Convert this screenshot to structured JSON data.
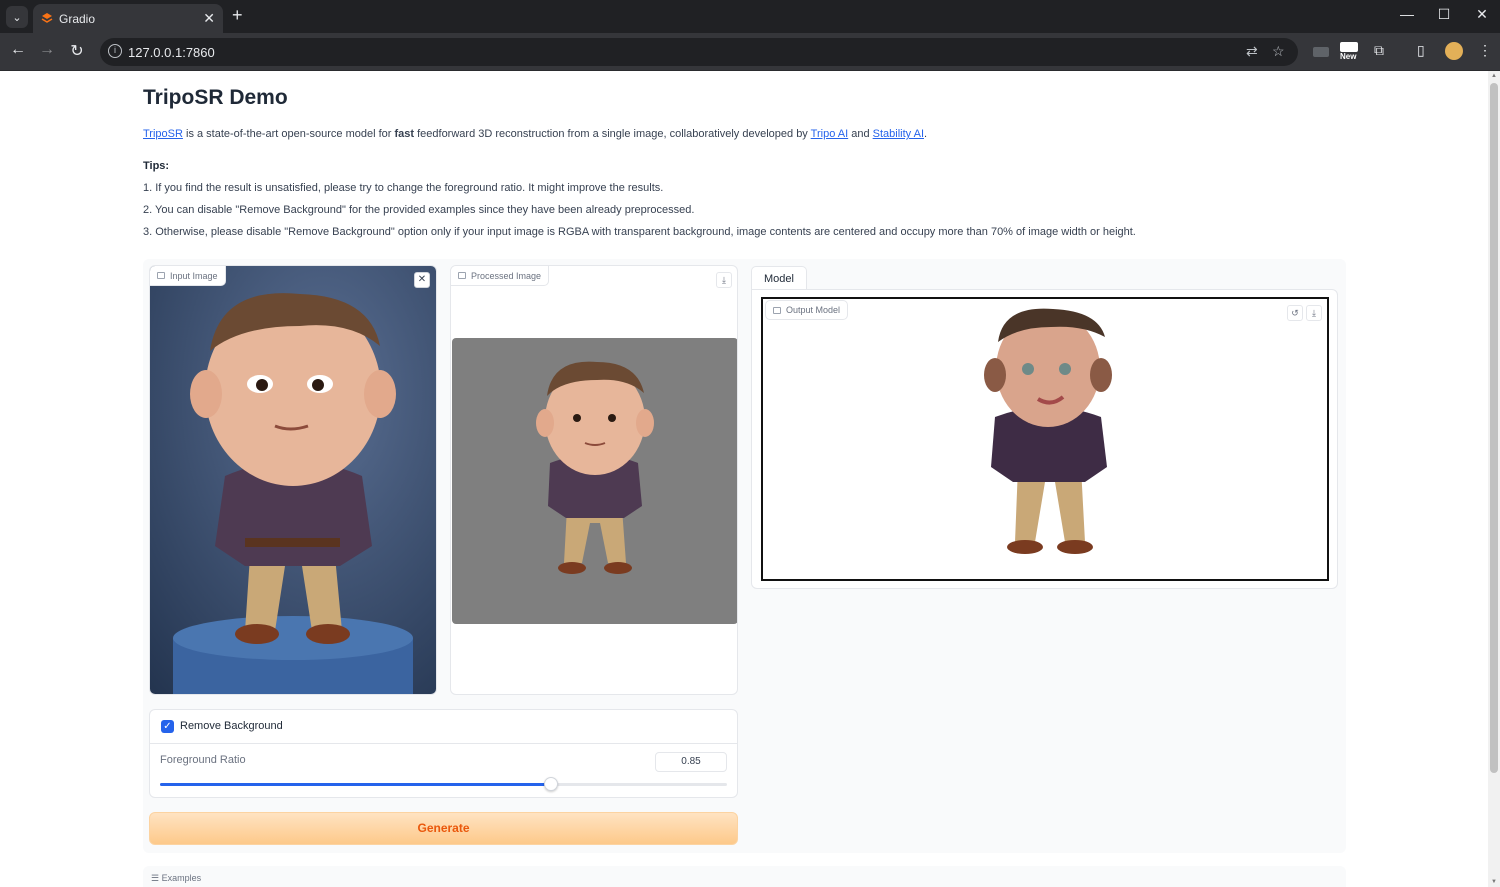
{
  "browser": {
    "tab_title": "Gradio",
    "url": "127.0.0.1:7860",
    "new_badge": "New"
  },
  "page": {
    "title": "TripoSR Demo",
    "intro": {
      "link1": "TripoSR",
      "text1": " is a state-of-the-art open-source model for ",
      "bold": "fast",
      "text2": " feedforward 3D reconstruction from a single image, collaboratively developed by ",
      "link2": "Tripo AI",
      "text3": " and ",
      "link3": "Stability AI",
      "text4": "."
    },
    "tips_title": "Tips:",
    "tips": [
      "1. If you find the result is unsatisfied, please try to change the foreground ratio. It might improve the results.",
      "2. You can disable \"Remove Background\" for the provided examples since they have been already preprocessed.",
      "3. Otherwise, please disable \"Remove Background\" option only if your input image is RGBA with transparent background, image contents are centered and occupy more than 70% of image width or height."
    ]
  },
  "input_image": {
    "label": "Input Image"
  },
  "processed_image": {
    "label": "Processed Image"
  },
  "model": {
    "tab_label": "Model",
    "output_label": "Output Model"
  },
  "controls": {
    "remove_background_label": "Remove Background",
    "remove_background_checked": true,
    "foreground_ratio_label": "Foreground Ratio",
    "foreground_ratio_value": "0.85",
    "slider_fraction": 0.69
  },
  "generate_label": "Generate",
  "examples_label": "Examples",
  "colors": {
    "accent": "#2563eb",
    "generate_text": "#ea580c"
  }
}
